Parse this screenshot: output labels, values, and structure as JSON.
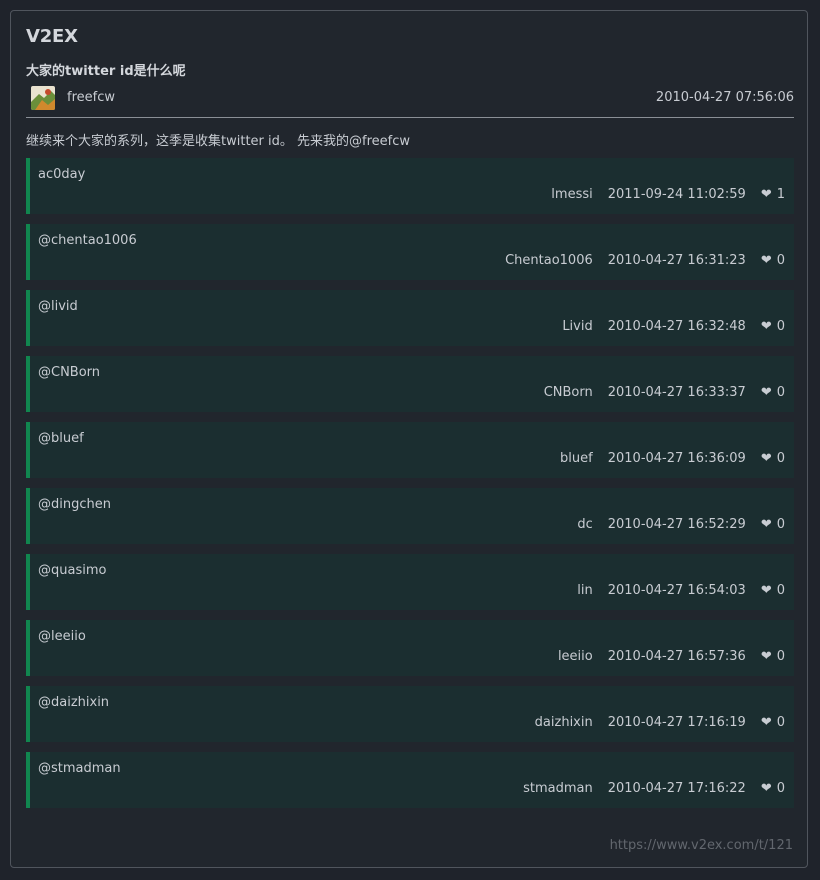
{
  "site": {
    "name": "V2EX"
  },
  "topic": {
    "title": "大家的twitter id是什么呢",
    "author": "freefcw",
    "created": "2010-04-27 07:56:06",
    "content": "继续来个大家的系列，这季是收集twitter id。 先来我的@freefcw"
  },
  "replies": [
    {
      "text": "ac0day",
      "author": "lmessi",
      "time": "2011-09-24 11:02:59",
      "likes": "1"
    },
    {
      "text": "@chentao1006",
      "author": "Chentao1006",
      "time": "2010-04-27 16:31:23",
      "likes": "0"
    },
    {
      "text": "@livid",
      "author": "Livid",
      "time": "2010-04-27 16:32:48",
      "likes": "0"
    },
    {
      "text": "@CNBorn",
      "author": "CNBorn",
      "time": "2010-04-27 16:33:37",
      "likes": "0"
    },
    {
      "text": "@bluef",
      "author": "bluef",
      "time": "2010-04-27 16:36:09",
      "likes": "0"
    },
    {
      "text": "@dingchen",
      "author": "dc",
      "time": "2010-04-27 16:52:29",
      "likes": "0"
    },
    {
      "text": "@quasimo",
      "author": "lin",
      "time": "2010-04-27 16:54:03",
      "likes": "0"
    },
    {
      "text": "@leeiio",
      "author": "leeiio",
      "time": "2010-04-27 16:57:36",
      "likes": "0"
    },
    {
      "text": "@daizhixin",
      "author": "daizhixin",
      "time": "2010-04-27 17:16:19",
      "likes": "0"
    },
    {
      "text": "@stmadman",
      "author": "stmadman",
      "time": "2010-04-27 17:16:22",
      "likes": "0"
    }
  ],
  "footer": {
    "url": "https://www.v2ex.com/t/121"
  },
  "icons": {
    "avatar": "avatar-image",
    "like": "heart-icon"
  },
  "colors": {
    "accent": "#11864f",
    "reply_bg": "#1b2e30",
    "page_bg": "#1f232b"
  }
}
